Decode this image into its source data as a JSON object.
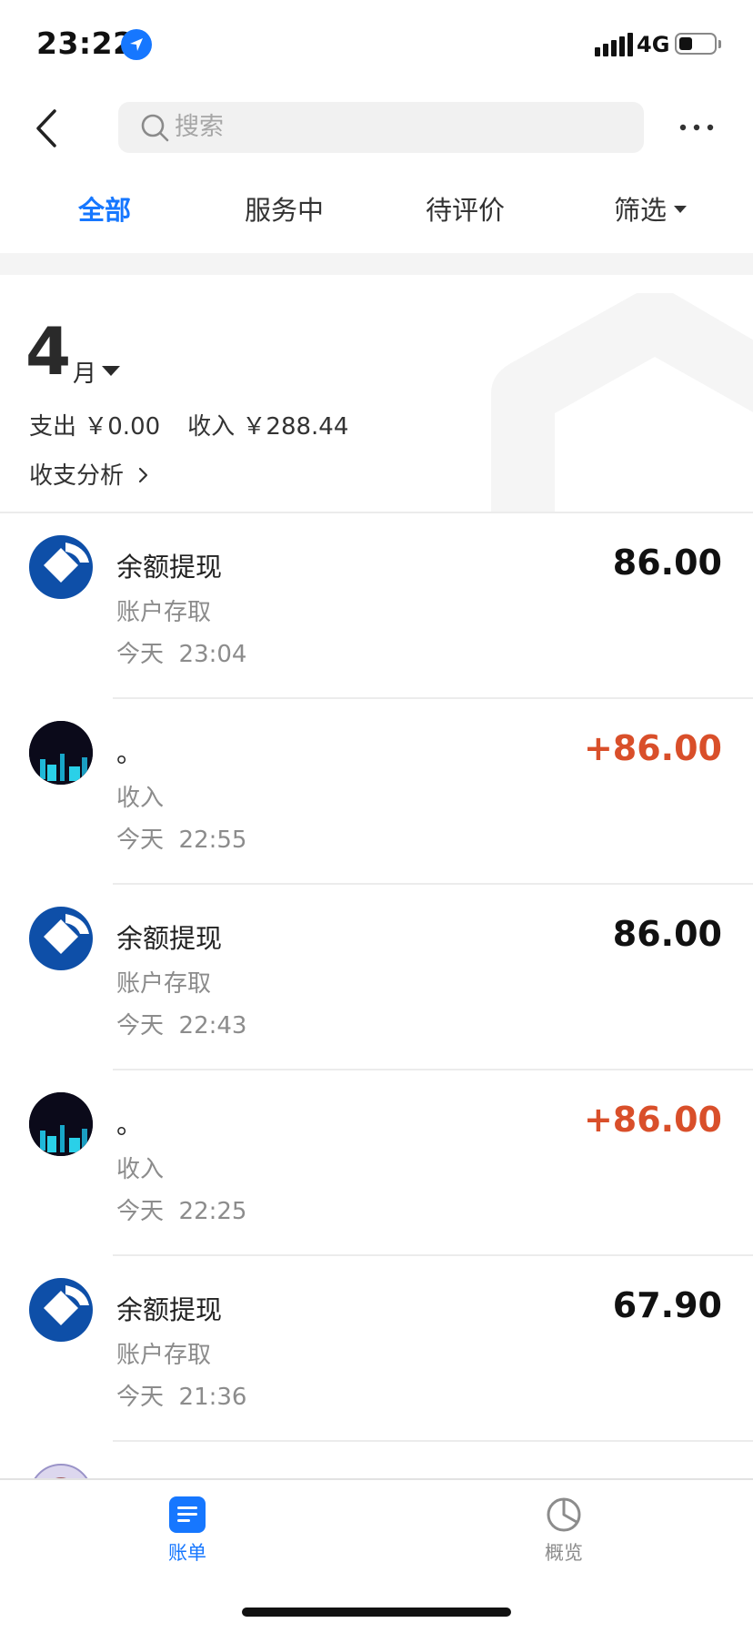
{
  "status": {
    "time": "23:22",
    "network": "4G"
  },
  "search": {
    "placeholder": "搜索"
  },
  "tabs": [
    {
      "label": "全部",
      "active": true
    },
    {
      "label": "服务中",
      "active": false
    },
    {
      "label": "待评价",
      "active": false
    },
    {
      "label": "筛选",
      "active": false
    }
  ],
  "summary": {
    "month_num": "4",
    "month_unit": "月",
    "expense": "支出 ￥0.00",
    "income": "收入 ￥288.44",
    "analysis": "收支分析"
  },
  "transactions": [
    {
      "icon": "bank-logo-icon",
      "title": "余额提现",
      "subtitle": "账户存取",
      "date": "今天",
      "time": "23:04",
      "amount": "86.00",
      "type": "withdraw"
    },
    {
      "icon": "user-avatar",
      "title": "。",
      "subtitle": "收入",
      "date": "今天",
      "time": "22:55",
      "amount": "+86.00",
      "type": "income"
    },
    {
      "icon": "bank-logo-icon",
      "title": "余额提现",
      "subtitle": "账户存取",
      "date": "今天",
      "time": "22:43",
      "amount": "86.00",
      "type": "withdraw"
    },
    {
      "icon": "user-avatar",
      "title": "。",
      "subtitle": "收入",
      "date": "今天",
      "time": "22:25",
      "amount": "+86.00",
      "type": "income"
    },
    {
      "icon": "bank-logo-icon",
      "title": "余额提现",
      "subtitle": "账户存取",
      "date": "今天",
      "time": "21:36",
      "amount": "67.90",
      "type": "withdraw"
    }
  ],
  "bottom_nav": [
    {
      "label": "账单",
      "icon": "bill-icon",
      "active": true
    },
    {
      "label": "概览",
      "icon": "pie-chart-icon",
      "active": false
    }
  ],
  "colors": {
    "accent": "#1677ff",
    "income": "#d94f2a",
    "bank": "#0e4fa8"
  }
}
